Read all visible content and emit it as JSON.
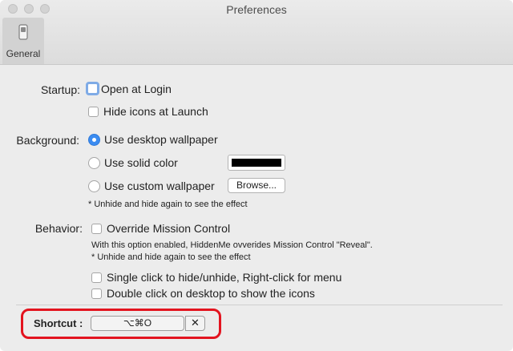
{
  "window": {
    "title": "Preferences"
  },
  "toolbar": {
    "tabs": [
      {
        "label": "General",
        "icon": "switch-icon",
        "selected": true
      }
    ]
  },
  "startup": {
    "label": "Startup:",
    "open_at_login": {
      "label": "Open at Login",
      "checked": false
    },
    "hide_icons_at_launch": {
      "label": "Hide icons at Launch",
      "checked": false
    }
  },
  "background": {
    "label": "Background:",
    "options": [
      {
        "label": "Use desktop wallpaper",
        "selected": true
      },
      {
        "label": "Use solid color",
        "selected": false
      },
      {
        "label": "Use custom wallpaper",
        "selected": false
      }
    ],
    "solid_color": "#000000",
    "browse_label": "Browse...",
    "note": "* Unhide and hide again to see the effect"
  },
  "behavior": {
    "label": "Behavior:",
    "override_mission_control": {
      "label": "Override Mission Control",
      "checked": false
    },
    "note_line1": "With this option enabled, HiddenMe ovverides Mission Control \"Reveal\".",
    "note_line2": "* Unhide and hide again to see the effect",
    "single_click": {
      "label": "Single click to hide/unhide, Right-click for menu",
      "checked": false
    },
    "double_click": {
      "label": "Double click on desktop to show the icons",
      "checked": false
    }
  },
  "shortcut": {
    "label": "Shortcut :",
    "value": "⌥⌘O",
    "clear_label": "✕",
    "highlight_color": "#e3141f"
  },
  "colors": {
    "accent": "#3b8cf1",
    "focus_ring": "#7fabe6",
    "window_bg": "#ececec"
  }
}
